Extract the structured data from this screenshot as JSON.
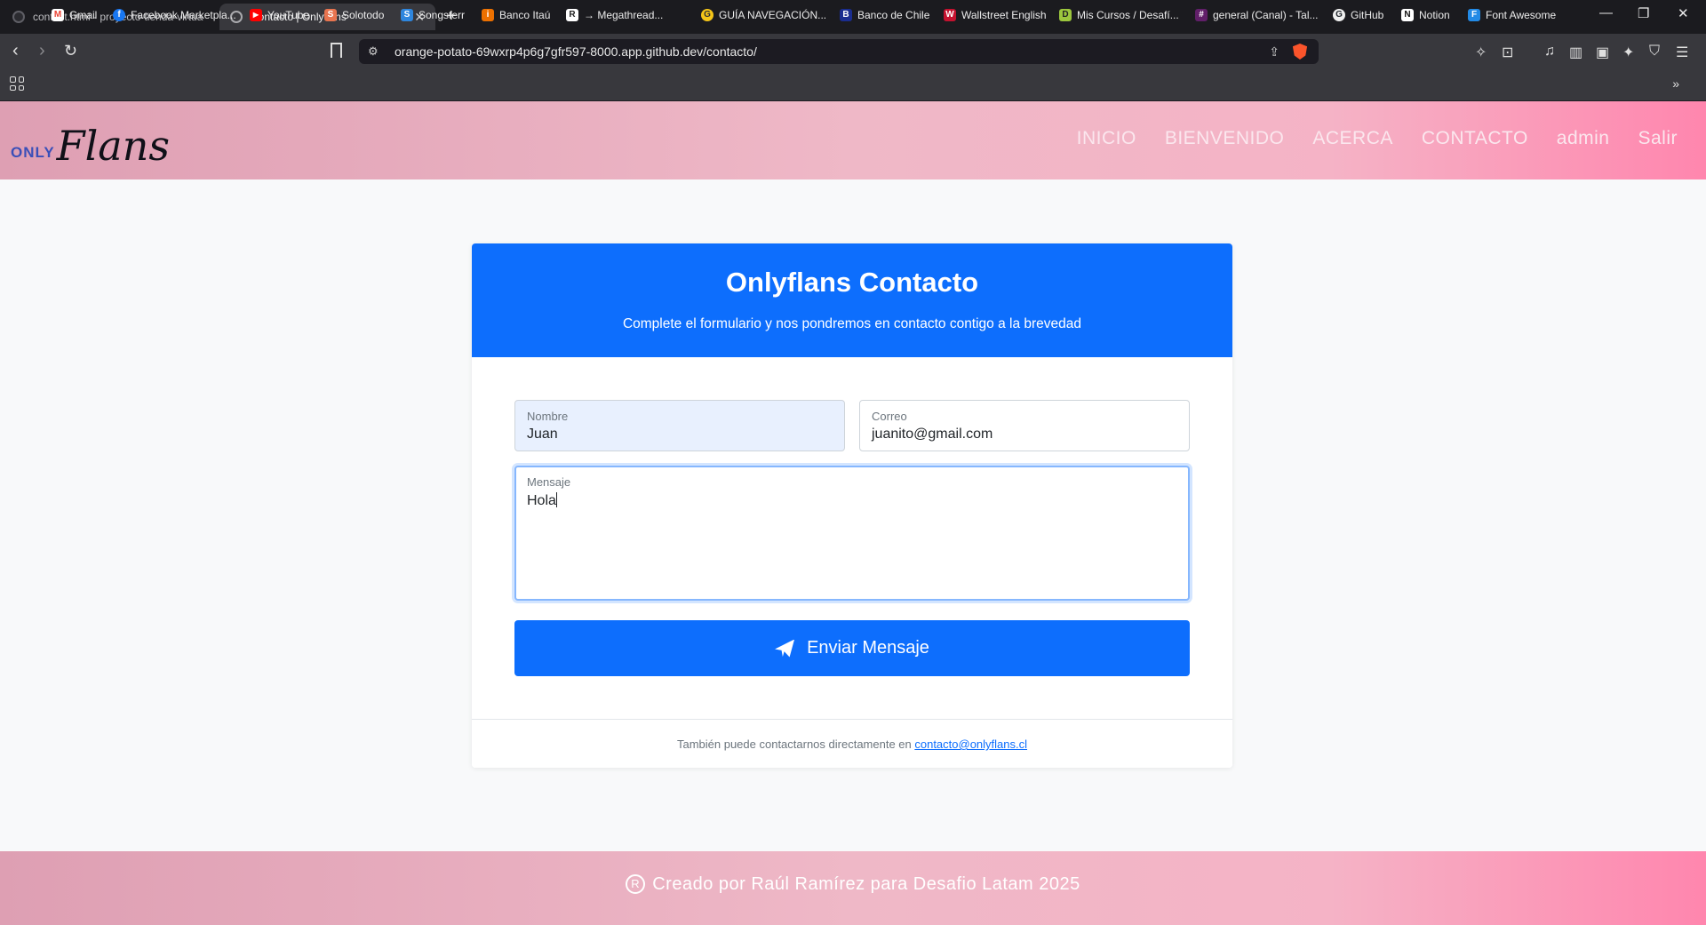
{
  "browser": {
    "tabs": [
      {
        "title": "contact.html - proyecto-tienda-virtua"
      },
      {
        "title": "Contacto | Onlyflans"
      }
    ],
    "url": "orange-potato-69wxrp4p6g7gfr597-8000.app.github.dev/contacto/",
    "bookmarks": [
      {
        "label": "Gmail",
        "color": "#ea4335",
        "glyph": "M"
      },
      {
        "label": "Facebook Marketpla...",
        "color": "#1877f2",
        "glyph": "f"
      },
      {
        "label": "YouTube",
        "color": "#ff0000",
        "glyph": "▶"
      },
      {
        "label": "Solotodo",
        "color": "#e8744f",
        "glyph": "S"
      },
      {
        "label": "Songsterr",
        "color": "#2e86de",
        "glyph": "S"
      },
      {
        "label": "Banco Itaú",
        "color": "#ec7000",
        "glyph": "i"
      },
      {
        "label": "→ Megathread...",
        "color": "#ffffff",
        "glyph": "R"
      },
      {
        "label": "GUÍA NAVEGACIÓN...",
        "color": "#f5c518",
        "glyph": "G"
      },
      {
        "label": "Banco de Chile",
        "color": "#1a2d8f",
        "glyph": "B"
      },
      {
        "label": "Wallstreet English",
        "color": "#c4122f",
        "glyph": "W"
      },
      {
        "label": "Mis Cursos / Desafí...",
        "color": "#9bc53d",
        "glyph": "D"
      },
      {
        "label": "general (Canal) - Tal...",
        "color": "#611f69",
        "glyph": "#"
      },
      {
        "label": "GitHub",
        "color": "#24292f",
        "glyph": "G"
      },
      {
        "label": "Notion",
        "color": "#ffffff",
        "glyph": "N"
      },
      {
        "label": "Font Awesome",
        "color": "#228ae6",
        "glyph": "F"
      }
    ]
  },
  "site": {
    "logo": {
      "prefix": "ONLY",
      "script": "Flans"
    },
    "nav": [
      "INICIO",
      "BIENVENIDO",
      "ACERCA",
      "CONTACTO",
      "admin",
      "Salir"
    ],
    "card": {
      "title": "Onlyflans Contacto",
      "subtitle": "Complete el formulario y nos pondremos en contacto contigo a la brevedad",
      "name_label": "Nombre",
      "name_value": "Juan",
      "email_label": "Correo",
      "email_value": "juanito@gmail.com",
      "message_label": "Mensaje",
      "message_value": "Hola",
      "send_label": "Enviar Mensaje",
      "footer_text": "También puede contactarnos directamente en",
      "footer_email": "contacto@onlyflans.cl"
    },
    "footer": "Creado por Raúl Ramírez para Desafio Latam 2025",
    "accent": "#0d6efd"
  }
}
